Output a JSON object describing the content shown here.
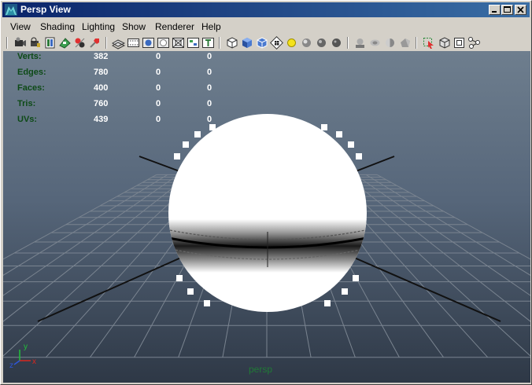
{
  "window": {
    "title": "Persp View",
    "controls": {
      "minimize": "minimize",
      "maximize": "maximize",
      "close": "close"
    }
  },
  "menu": [
    "View",
    "Shading",
    "Lighting",
    "Show",
    "Renderer",
    "Help"
  ],
  "toolbar": {
    "groups": [
      [
        "select-camera-icon",
        "lock-camera-icon",
        "camera-attributes-icon",
        "bookmarks-icon",
        "image-plane-icon",
        "2d-pan-zoom-icon"
      ],
      [
        "grid-toggle-icon",
        "film-gate-icon",
        "resolution-gate-icon",
        "gate-mask-icon",
        "field-chart-icon",
        "safe-title-icon"
      ],
      [
        "wireframe-icon",
        "smooth-shade-icon",
        "wireframe-on-shaded-icon",
        "textured-icon",
        "use-all-lights-icon",
        "shadows-icon",
        "ambient-occlusion-icon",
        "antialiasing-icon"
      ],
      [
        "isolate-select-icon",
        "xray-icon",
        "xray-joints-icon",
        "backface-culling-icon"
      ],
      [
        "highlight-selection-icon",
        "select-box-icon",
        "frame-all-icon",
        "frame-selection-icon"
      ]
    ]
  },
  "heads_up_display": {
    "rows": [
      {
        "label": "Verts:",
        "values": [
          "382",
          "0",
          "0"
        ]
      },
      {
        "label": "Edges:",
        "values": [
          "780",
          "0",
          "0"
        ]
      },
      {
        "label": "Faces:",
        "values": [
          "400",
          "0",
          "0"
        ]
      },
      {
        "label": "Tris:",
        "values": [
          "760",
          "0",
          "0"
        ]
      },
      {
        "label": "UVs:",
        "values": [
          "439",
          "0",
          "0"
        ]
      }
    ]
  },
  "camera_name": "persp",
  "axis": {
    "x": "x",
    "y": "y",
    "z": "z"
  },
  "colors": {
    "viewport_top": "#6e7e8e",
    "viewport_bottom": "#2e3846",
    "hud_label": "#0d4a16",
    "hud_value": "#ffffff",
    "title_bar_start": "#0a246a",
    "title_bar_end": "#3a6ea5",
    "grid": "#7a8490",
    "axis_x": "#d8261e",
    "axis_y": "#22c03a",
    "axis_z": "#2f56d8"
  }
}
